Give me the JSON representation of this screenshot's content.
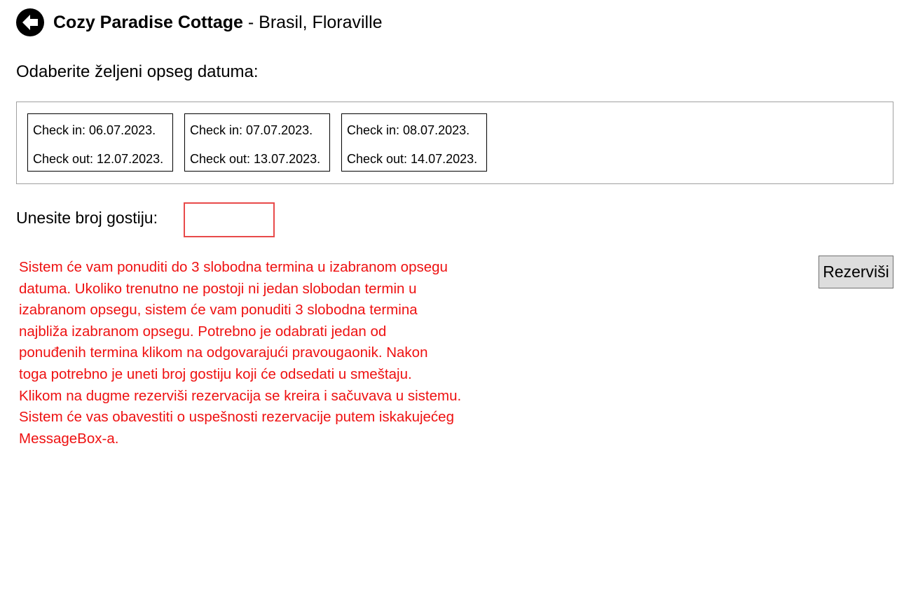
{
  "header": {
    "back_icon": "arrow-left-circle-icon",
    "accommodation_name": "Cozy Paradise Cottage",
    "location": " - Brasil, Floraville"
  },
  "date_section": {
    "label": "Odaberite željeni opseg datuma:",
    "options": [
      {
        "check_in": "Check in:  06.07.2023.",
        "check_out": "Check out:  12.07.2023."
      },
      {
        "check_in": "Check in:  07.07.2023.",
        "check_out": "Check out:  13.07.2023."
      },
      {
        "check_in": "Check in:  08.07.2023.",
        "check_out": "Check out:  14.07.2023."
      }
    ]
  },
  "guests": {
    "label": "Unesite broj gostiju:",
    "value": "",
    "error_color": "#e84a4a"
  },
  "info": {
    "color": "#ee1111",
    "lines": [
      "Sistem će vam ponuditi do 3 slobodna termina u izabranom opsegu",
      "datuma. Ukoliko trenutno ne postoji ni jedan slobodan termin u",
      "izabranom opsegu, sistem će vam ponuditi 3 slobodna termina",
      "najbliža izabranom opsegu. Potrebno je odabrati jedan od",
      "ponuđenih termina klikom na odgovarajući pravougaonik. Nakon",
      "toga potrebno je uneti broj gostiju koji će odsedati u smeštaju.",
      "Klikom na dugme rezerviši rezervacija se kreira i sačuvava u sistemu.",
      "Sistem će vas obavestiti o uspešnosti rezervacije putem iskakujećeg",
      "MessageBox-a."
    ]
  },
  "actions": {
    "reserve_label": "Rezerviši"
  }
}
